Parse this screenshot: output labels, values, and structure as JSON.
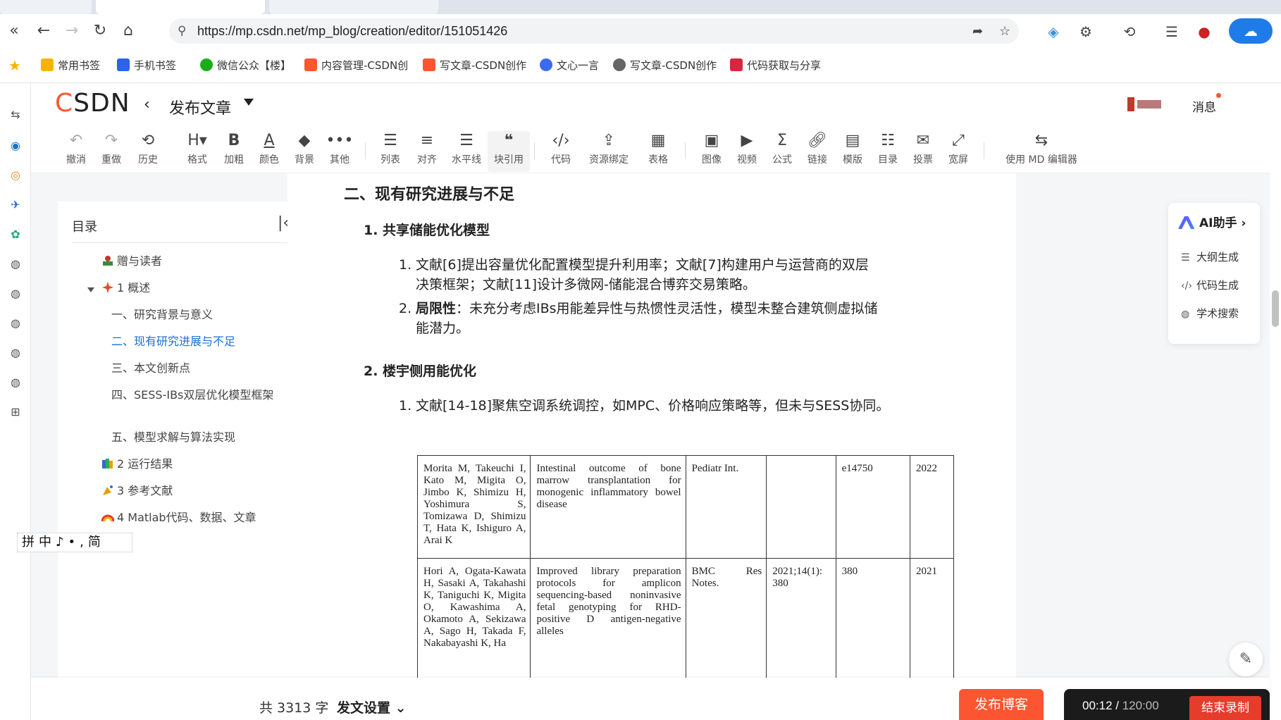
{
  "browser": {
    "url": "https://mp.csdn.net/mp_blog/creation/editor/151051426",
    "bookmarks": [
      {
        "label": "常用书签",
        "color": "#f6b400"
      },
      {
        "label": "手机书签",
        "color": "#2b64e8"
      },
      {
        "label": "微信公众【楼】",
        "color": "#1aad19"
      },
      {
        "label": "内容管理-CSDN创",
        "color": "#fc5531"
      },
      {
        "label": "写文章-CSDN创作",
        "color": "#fc5531"
      },
      {
        "label": "文心一言",
        "color": "#3b6cf0"
      },
      {
        "label": "写文章-CSDN创作",
        "color": "#666666"
      },
      {
        "label": "代码获取与分享",
        "color": "#d7263d"
      }
    ]
  },
  "header": {
    "logo_c": "C",
    "logo_rest": "SDN",
    "title": "发布文章",
    "messages": "消息"
  },
  "toolbar": {
    "undo": "撤消",
    "redo": "重做",
    "history": "历史",
    "format": "格式",
    "bold": "加粗",
    "color": "颜色",
    "background": "背景",
    "other": "其他",
    "list": "列表",
    "align": "对齐",
    "hr": "水平线",
    "quote": "块引用",
    "code": "代码",
    "resource": "资源绑定",
    "table": "表格",
    "image": "图像",
    "video": "视频",
    "formula": "公式",
    "link": "链接",
    "template": "模版",
    "toc": "目录",
    "vote": "投票",
    "wide": "宽屏",
    "md": "使用 MD 编辑器"
  },
  "toc": {
    "title": "目录",
    "items": [
      "赠与读者",
      "1 概述",
      "一、研究背景与意义",
      "二、现有研究进展与不足",
      "三、本文创新点",
      "四、SESS-IBs双层优化模型框架",
      "五、模型求解与算法实现",
      "2 运行结果",
      "3 参考文献",
      "4 Matlab代码、数据、文章"
    ]
  },
  "ime": "拼中♪•,简",
  "editor": {
    "h2": "二、现有研究进展与不足",
    "s1_title": "1. 共享储能优化模型",
    "s1_p1_num": "1.",
    "s1_p1": "文献[6]提出容量优化配置模型提升利用率；文献[7]构建用户与运营商的双层决策框架；文献[11]设计多微网-储能混合博弈交易策略。",
    "s1_p2_num": "2.",
    "s1_p2_bold": "局限性",
    "s1_p2": "：未充分考虑IBs用能差异性与热惯性灵活性，模型未整合建筑侧虚拟储能潜力。",
    "s2_title": "2. 楼宇侧用能优化",
    "s2_p1_num": "1.",
    "s2_p1": "文献[14-18]聚焦空调系统调控，如MPC、价格响应策略等，但未与SESS协同。",
    "table": [
      [
        "Morita M, Takeuchi I, Kato M, Migita O, Jimbo K, Shimizu H, Yoshimura S, Tomizawa D, Shimizu T, Hata K, Ishiguro A, Arai K",
        "Intestinal outcome of bone marrow transplantation for monogenic inflammatory bowel disease",
        "Pediatr Int.",
        "",
        "e14750",
        "2022"
      ],
      [
        "Hori A, Ogata-Kawata H, Sasaki A, Takahashi K, Taniguchi K, Migita O, Kawashima A, Okamoto A, Sekizawa A, Sago H, Takada F, Nakabayashi K, Ha",
        "Improved library preparation protocols for amplicon sequencing-based noninvasive fetal genotyping for RHD-positive D antigen-negative alleles",
        "BMC Res Notes.",
        "2021;14(1): 380",
        "380",
        "2021"
      ]
    ]
  },
  "ai": {
    "title": "AI助手",
    "items": [
      "大纲生成",
      "代码生成",
      "学术搜索"
    ]
  },
  "bottom": {
    "word_count": "共 3313 字",
    "settings": "发文设置",
    "publish": "发布博客",
    "rec_elapsed": "00:12",
    "rec_total": "120:00",
    "rec_stop": "结束录制"
  },
  "colors": {
    "brand": "#fc5531",
    "link": "#1a6fd6",
    "rec_stop": "#e63c2c"
  }
}
